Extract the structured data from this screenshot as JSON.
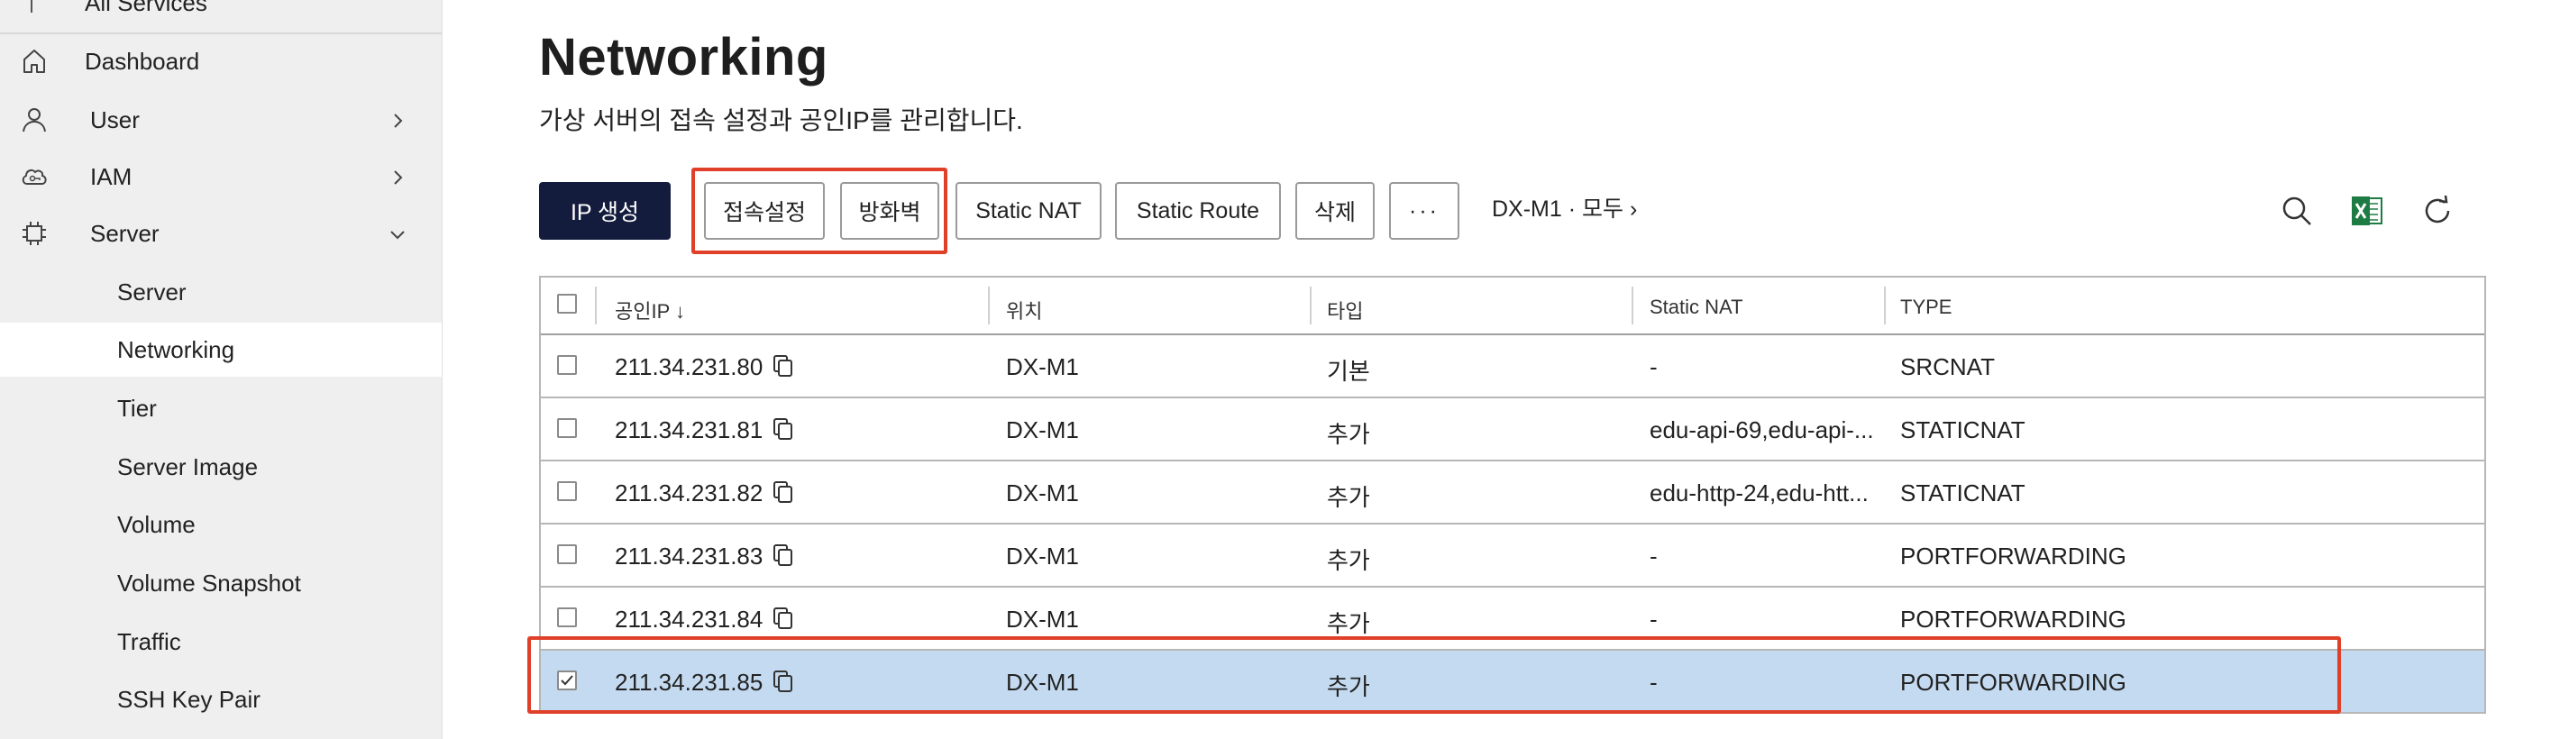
{
  "sidebar": {
    "top_label": "All Services",
    "items": [
      {
        "label": "Dashboard",
        "icon": "home-icon"
      },
      {
        "label": "User",
        "icon": "user-icon",
        "chevron": "right"
      },
      {
        "label": "IAM",
        "icon": "cloud-icon",
        "chevron": "right"
      },
      {
        "label": "Server",
        "icon": "chip-icon",
        "chevron": "down"
      },
      {
        "label": "Server"
      },
      {
        "label": "Networking",
        "active": true
      },
      {
        "label": "Tier"
      },
      {
        "label": "Server Image"
      },
      {
        "label": "Volume"
      },
      {
        "label": "Volume Snapshot"
      },
      {
        "label": "Traffic"
      },
      {
        "label": "SSH Key Pair"
      }
    ]
  },
  "page": {
    "title": "Networking",
    "subtitle": "가상 서버의 접속 설정과 공인IP를 관리합니다."
  },
  "toolbar": {
    "create_ip": "IP 생성",
    "access_settings": "접속설정",
    "firewall": "방화벽",
    "static_nat": "Static NAT",
    "static_route": "Static Route",
    "delete": "삭제",
    "more": "···",
    "filter": "DX-M1 · 모두 ›"
  },
  "table": {
    "headers": [
      "공인IP ↓",
      "위치",
      "타입",
      "Static NAT",
      "TYPE"
    ],
    "rows": [
      {
        "ip": "211.34.231.80",
        "location": "DX-M1",
        "type": "기본",
        "static_nat": "-",
        "nat_type": "SRCNAT",
        "checked": false
      },
      {
        "ip": "211.34.231.81",
        "location": "DX-M1",
        "type": "추가",
        "static_nat": "edu-api-69,edu-api-...",
        "nat_type": "STATICNAT",
        "checked": false
      },
      {
        "ip": "211.34.231.82",
        "location": "DX-M1",
        "type": "추가",
        "static_nat": "edu-http-24,edu-htt...",
        "nat_type": "STATICNAT",
        "checked": false
      },
      {
        "ip": "211.34.231.83",
        "location": "DX-M1",
        "type": "추가",
        "static_nat": "-",
        "nat_type": "PORTFORWARDING",
        "checked": false
      },
      {
        "ip": "211.34.231.84",
        "location": "DX-M1",
        "type": "추가",
        "static_nat": "-",
        "nat_type": "PORTFORWARDING",
        "checked": false
      },
      {
        "ip": "211.34.231.85",
        "location": "DX-M1",
        "type": "추가",
        "static_nat": "-",
        "nat_type": "PORTFORWARDING",
        "checked": true
      }
    ]
  },
  "colors": {
    "primary_button": "#141c3d",
    "highlight": "#e0402a",
    "selected_row": "#c4daf0",
    "excel_green": "#1e7b43"
  }
}
